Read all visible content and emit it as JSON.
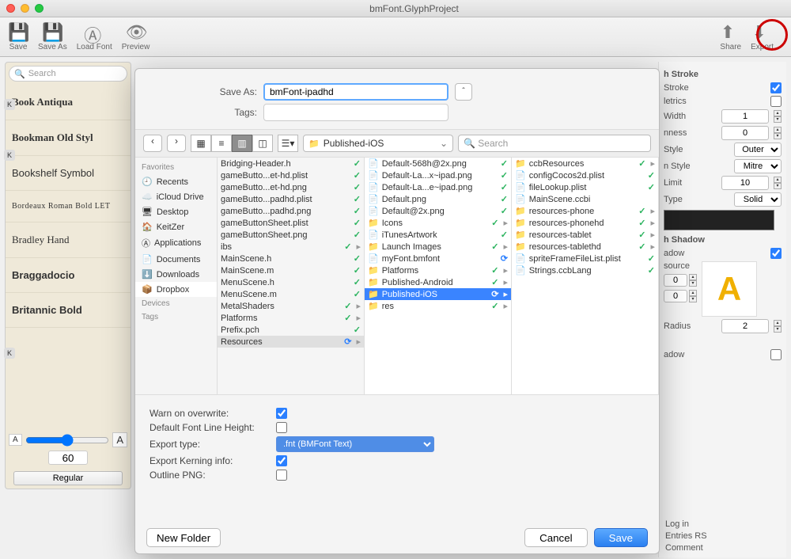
{
  "window": {
    "title": "bmFont.GlyphProject"
  },
  "toolbar": {
    "save": "Save",
    "saveAs": "Save As",
    "loadFont": "Load Font",
    "preview": "Preview",
    "share": "Share",
    "export": "Export"
  },
  "leftSearch": {
    "placeholder": "Search"
  },
  "fonts": {
    "0": "Book Antiqua",
    "1": "Bookman Old Styl",
    "2": "Bookshelf Symbol",
    "3": "Bordeaux Roman Bold LET",
    "4": "Bradley Hand",
    "5": "Braggadocio",
    "6": "Britannic Bold"
  },
  "fontSize": "60",
  "regularBtn": "Regular",
  "inspector": {
    "strokeHead": "h Stroke",
    "stroke": "Stroke",
    "metrics": "letrics",
    "width": "Width",
    "widthVal": "1",
    "nness": "nness",
    "nnessVal": "0",
    "style": "Style",
    "styleVal": "Outer",
    "nstyle": "n Style",
    "nstyleVal": "Mitre",
    "limit": "Limit",
    "limitVal": "10",
    "type": "Type",
    "typeVal": "Solid",
    "shadowHead": "h Shadow",
    "shadow": "adow",
    "source": "source",
    "radius": "Radius",
    "radiusVal": "2",
    "adow2": "adow",
    "rssLogin": "Log in",
    "rssEntries": "Entries RS",
    "rssComments": "Comment"
  },
  "dialog": {
    "saveAsLabel": "Save As:",
    "saveAsVal": "bmFont-ipadhd",
    "tagsLabel": "Tags:",
    "folderSelect": "Published-iOS",
    "searchPlaceholder": "Search",
    "sidebar": {
      "favorites": "Favorites",
      "recents": "Recents",
      "icloud": "iCloud Drive",
      "desktop": "Desktop",
      "keitzer": "KeitZer",
      "apps": "Applications",
      "docs": "Documents",
      "downloads": "Downloads",
      "dropbox": "Dropbox",
      "devices": "Devices",
      "tags": "Tags"
    },
    "col1": {
      "0": "Bridging-Header.h",
      "1": "gameButto...et-hd.plist",
      "2": "gameButto...et-hd.png",
      "3": "gameButto...padhd.plist",
      "4": "gameButto...padhd.png",
      "5": "gameButtonSheet.plist",
      "6": "gameButtonSheet.png",
      "7": "ibs",
      "8": "MainScene.h",
      "9": "MainScene.m",
      "10": "MenuScene.h",
      "11": "MenuScene.m",
      "12": "MetalShaders",
      "13": "Platforms",
      "14": "Prefix.pch",
      "15": "Resources"
    },
    "col2": {
      "0": "Default-568h@2x.png",
      "1": "Default-La...x~ipad.png",
      "2": "Default-La...e~ipad.png",
      "3": "Default.png",
      "4": "Default@2x.png",
      "5": "Icons",
      "6": "iTunesArtwork",
      "7": "Launch Images",
      "8": "myFont.bmfont",
      "9": "Platforms",
      "10": "Published-Android",
      "11": "Published-iOS",
      "12": "res"
    },
    "col3": {
      "0": "ccbResources",
      "1": "configCocos2d.plist",
      "2": "fileLookup.plist",
      "3": "MainScene.ccbi",
      "4": "resources-phone",
      "5": "resources-phonehd",
      "6": "resources-tablet",
      "7": "resources-tablethd",
      "8": "spriteFrameFileList.plist",
      "9": "Strings.ccbLang"
    },
    "opts": {
      "warn": "Warn on overwrite:",
      "defHeight": "Default Font Line Height:",
      "exportType": "Export type:",
      "exportTypeVal": ".fnt (BMFont Text)",
      "kerning": "Export Kerning info:",
      "outline": "Outline PNG:"
    },
    "newFolder": "New Folder",
    "cancel": "Cancel",
    "save": "Save"
  }
}
